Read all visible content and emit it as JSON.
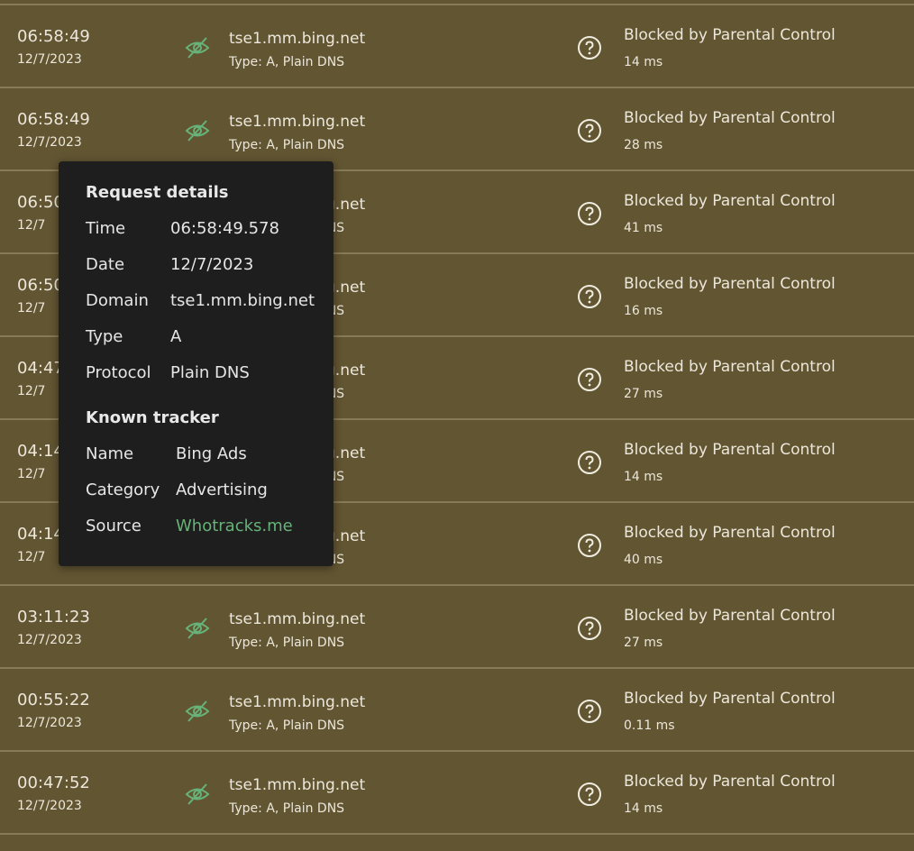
{
  "rows": [
    {
      "time": "06:58:49",
      "date": "12/7/2023",
      "domain": "tse1.mm.bing.net",
      "type": "Type: A, Plain DNS",
      "status": "Blocked by Parental Control",
      "elapsed": "14 ms"
    },
    {
      "time": "06:58:49",
      "date": "12/7/2023",
      "domain": "tse1.mm.bing.net",
      "type": "Type: A, Plain DNS",
      "status": "Blocked by Parental Control",
      "elapsed": "28 ms"
    },
    {
      "time": "06:50",
      "date": "12/7",
      "domain": "tse1.mm.bing.net",
      "type": "Type: A, Plain DNS",
      "status": "Blocked by Parental Control",
      "elapsed": "41 ms"
    },
    {
      "time": "06:50",
      "date": "12/7",
      "domain": "tse1.mm.bing.net",
      "type": "Type: A, Plain DNS",
      "status": "Blocked by Parental Control",
      "elapsed": "16 ms"
    },
    {
      "time": "04:47",
      "date": "12/7",
      "domain": "tse1.mm.bing.net",
      "type": "Type: A, Plain DNS",
      "status": "Blocked by Parental Control",
      "elapsed": "27 ms"
    },
    {
      "time": "04:14",
      "date": "12/7",
      "domain": "tse1.mm.bing.net",
      "type": "Type: A, Plain DNS",
      "status": "Blocked by Parental Control",
      "elapsed": "14 ms"
    },
    {
      "time": "04:14",
      "date": "12/7",
      "domain": "tse1.mm.bing.net",
      "type": "Type: A, Plain DNS",
      "status": "Blocked by Parental Control",
      "elapsed": "40 ms"
    },
    {
      "time": "03:11:23",
      "date": "12/7/2023",
      "domain": "tse1.mm.bing.net",
      "type": "Type: A, Plain DNS",
      "status": "Blocked by Parental Control",
      "elapsed": "27 ms"
    },
    {
      "time": "00:55:22",
      "date": "12/7/2023",
      "domain": "tse1.mm.bing.net",
      "type": "Type: A, Plain DNS",
      "status": "Blocked by Parental Control",
      "elapsed": "0.11 ms"
    },
    {
      "time": "00:47:52",
      "date": "12/7/2023",
      "domain": "tse1.mm.bing.net",
      "type": "Type: A, Plain DNS",
      "status": "Blocked by Parental Control",
      "elapsed": "14 ms"
    }
  ],
  "tooltip": {
    "heading": "Request details",
    "details": [
      {
        "label": "Time",
        "value": "06:58:49.578"
      },
      {
        "label": "Date",
        "value": "12/7/2023"
      },
      {
        "label": "Domain",
        "value": "tse1.mm.bing.net"
      },
      {
        "label": "Type",
        "value": "A"
      },
      {
        "label": "Protocol",
        "value": "Plain DNS"
      }
    ],
    "tracker_heading": "Known tracker",
    "tracker": [
      {
        "label": "Name",
        "value": "Bing Ads"
      },
      {
        "label": "Category",
        "value": "Advertising"
      },
      {
        "label": "Source",
        "value": "Whotracks.me"
      }
    ]
  },
  "icons": {
    "tracker": "eye-slash-icon",
    "help": "question-circle-icon"
  },
  "colors": {
    "background": "#625532",
    "divider": "#877a56",
    "tracker_icon": "#67b279",
    "tooltip_bg": "#1e1e1e",
    "link": "#67b279"
  }
}
